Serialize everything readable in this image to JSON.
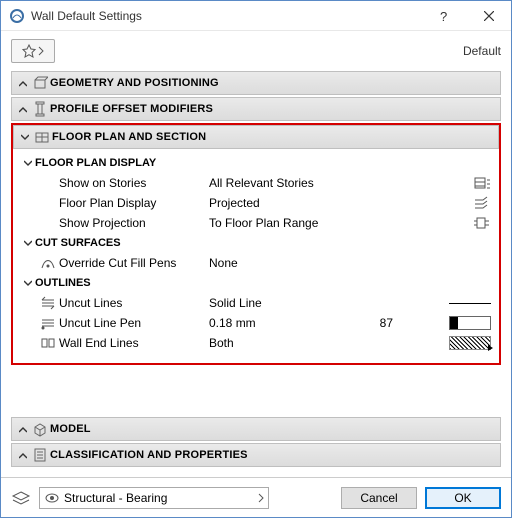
{
  "window": {
    "title": "Wall Default Settings"
  },
  "topbar": {
    "default_label": "Default"
  },
  "groups": {
    "geometry": "GEOMETRY AND POSITIONING",
    "profile": "PROFILE OFFSET MODIFIERS",
    "floorplan": "FLOOR PLAN AND SECTION",
    "model": "MODEL",
    "classification": "CLASSIFICATION AND PROPERTIES"
  },
  "floorplan": {
    "display_hdr": "FLOOR PLAN DISPLAY",
    "rows": {
      "show_on_stories": {
        "label": "Show on Stories",
        "value": "All Relevant Stories"
      },
      "fp_display": {
        "label": "Floor Plan Display",
        "value": "Projected"
      },
      "show_projection": {
        "label": "Show Projection",
        "value": "To Floor Plan Range"
      }
    },
    "cut_hdr": "CUT SURFACES",
    "cut": {
      "override": {
        "label": "Override Cut Fill Pens",
        "value": "None"
      }
    },
    "outlines_hdr": "OUTLINES",
    "outlines": {
      "uncut_lines": {
        "label": "Uncut Lines",
        "value": "Solid Line"
      },
      "uncut_pen": {
        "label": "Uncut Line Pen",
        "value": "0.18 mm",
        "extra": "87"
      },
      "wall_end": {
        "label": "Wall End Lines",
        "value": "Both"
      }
    }
  },
  "footer": {
    "layer": "Structural - Bearing",
    "cancel": "Cancel",
    "ok": "OK"
  }
}
